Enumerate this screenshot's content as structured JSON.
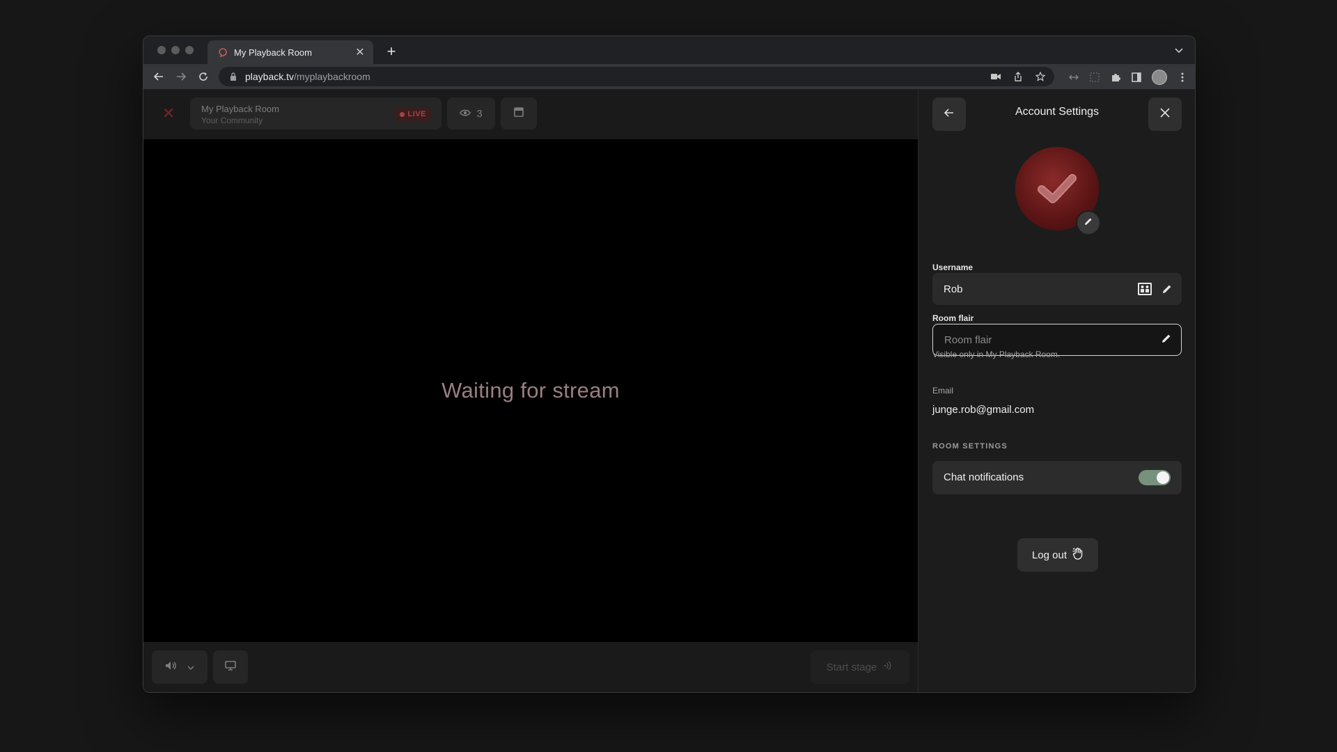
{
  "browser": {
    "tab_title": "My Playback Room",
    "url_host": "playback.tv",
    "url_path": "/myplaybackroom"
  },
  "room": {
    "name": "My Playback Room",
    "community": "Your Community",
    "live_label": "LIVE",
    "viewer_count": "3",
    "waiting_text": "Waiting for stream",
    "start_stage_label": "Start stage"
  },
  "settings": {
    "title": "Account Settings",
    "username_label": "Username",
    "username_value": "Rob",
    "room_flair_label": "Room flair",
    "room_flair_placeholder": "Room flair",
    "room_flair_hint": "Visible only in My Playback Room.",
    "email_label": "Email",
    "email_value": "junge.rob@gmail.com",
    "section_label": "ROOM SETTINGS",
    "chat_notifications_label": "Chat notifications",
    "chat_notifications_on": true,
    "logout_label": "Log out"
  },
  "colors": {
    "live_red": "#a34545",
    "toggle_on": "#77917d",
    "avatar_red": "#7a1f1f"
  },
  "icons": [
    "traffic-lights",
    "playback-logo-icon",
    "close-icon",
    "plus-icon",
    "back-arrow-icon",
    "forward-arrow-icon",
    "reload-icon",
    "lock-icon",
    "camera-icon",
    "share-icon",
    "star-icon",
    "eye-icon",
    "layout-icon",
    "volume-icon",
    "chevron-down-icon",
    "screen-icon",
    "broadcast-icon",
    "pencil-icon",
    "id-card-icon",
    "wave-hand-icon"
  ]
}
